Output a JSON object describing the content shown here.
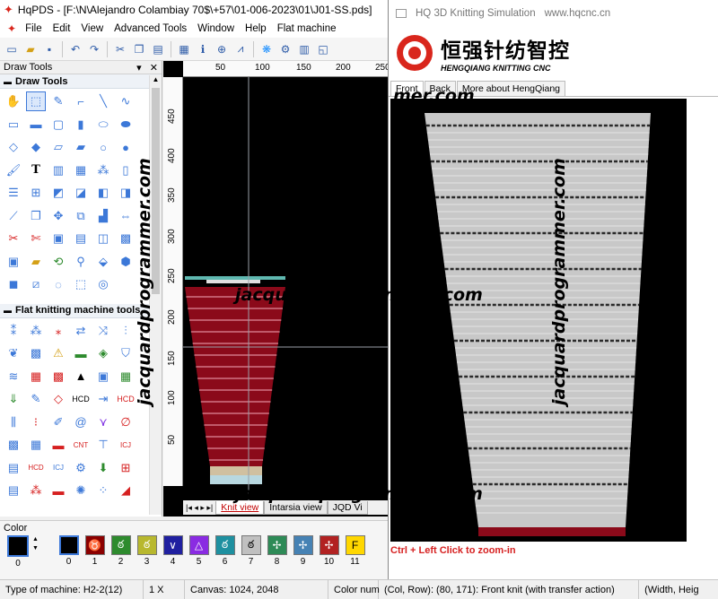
{
  "app": {
    "title": "HqPDS - [F:\\N\\Alejandro Colambiay 70$\\+57\\01-006-2023\\01\\J01-SS.pds]"
  },
  "menu": [
    "File",
    "Edit",
    "View",
    "Advanced Tools",
    "Window",
    "Help",
    "Flat machine"
  ],
  "toolbar_icons": [
    "new-icon",
    "open-icon",
    "save-icon",
    "undo-icon",
    "redo-icon",
    "cut-icon",
    "copy-icon",
    "paste-icon",
    "grid-icon",
    "info-icon",
    "zoom-icon",
    "color-icon",
    "options-icon",
    "table-icon",
    "view-icon"
  ],
  "draw_panel": {
    "header": "Draw Tools",
    "section1": "Draw Tools",
    "section2": "Flat knitting machine tools"
  },
  "ruler": {
    "top": [
      "50",
      "100",
      "150",
      "200",
      "250"
    ],
    "left": [
      "450",
      "400",
      "350",
      "300",
      "250",
      "200",
      "150",
      "100",
      "50"
    ]
  },
  "view_tabs": [
    "Knit view",
    "Intarsia view",
    "JQD Vi"
  ],
  "color": {
    "title": "Color",
    "current_index": "0",
    "swatches": [
      {
        "num": "0",
        "bg": "#000000"
      },
      {
        "num": "1",
        "bg": "#8b0000"
      },
      {
        "num": "2",
        "bg": "#2e8b2e"
      },
      {
        "num": "3",
        "bg": "#b8b82e"
      },
      {
        "num": "4",
        "bg": "#2020a0"
      },
      {
        "num": "5",
        "bg": "#8a2be2"
      },
      {
        "num": "6",
        "bg": "#1e90a0"
      },
      {
        "num": "7",
        "bg": "#c0c0c0"
      },
      {
        "num": "8",
        "bg": "#2e8b57"
      },
      {
        "num": "9",
        "bg": "#4682b4"
      },
      {
        "num": "10",
        "bg": "#b22222"
      },
      {
        "num": "11",
        "bg": "#ffd700"
      }
    ]
  },
  "status": {
    "machine": "Type of machine: H2-2(12)",
    "zoom": "1 X",
    "canvas": "Canvas: 1024, 2048",
    "color_num": "Color num",
    "col_row": "(Col, Row): (80, 171)",
    "stitch": ": Front knit (with transfer action)",
    "size": "(Width, Heig"
  },
  "sim": {
    "title": "HQ 3D Knitting Simulation",
    "url": "www.hqcnc.cn",
    "logo_cn": "恒强针纺智控",
    "logo_en": "HENGQIANG KNITTING CNC",
    "tabs": [
      "Front",
      "Back",
      "More about HengQiang"
    ],
    "hint": "Ctrl + Left Click to zoom-in"
  },
  "watermark": "jacquardprogrammer.com",
  "watermark_fragment": ".com",
  "watermark_top": "mer.com"
}
